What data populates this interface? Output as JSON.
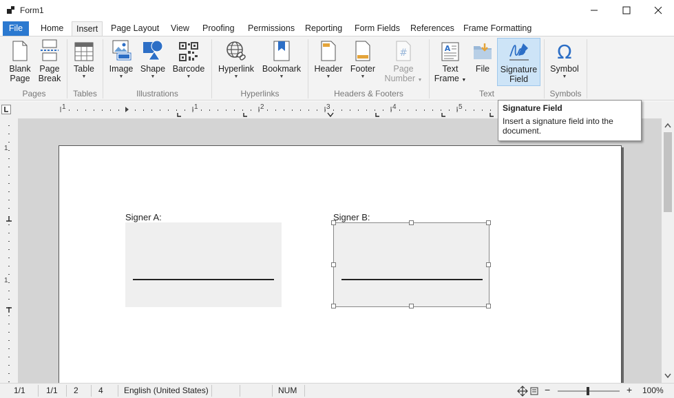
{
  "window": {
    "title": "Form1"
  },
  "tabs": [
    "File",
    "Home",
    "Insert",
    "Page Layout",
    "View",
    "Proofing",
    "Permissions",
    "Reporting",
    "Form Fields",
    "References",
    "Frame Formatting"
  ],
  "ribbon": {
    "blank_page": [
      "Blank",
      "Page"
    ],
    "page_break": [
      "Page",
      "Break"
    ],
    "table": "Table",
    "image": "Image",
    "shape": "Shape",
    "barcode": "Barcode",
    "hyperlink": "Hyperlink",
    "bookmark": "Bookmark",
    "header": "Header",
    "footer": "Footer",
    "page_number": [
      "Page",
      "Number"
    ],
    "text_frame": [
      "Text",
      "Frame"
    ],
    "file": "File",
    "signature_field": [
      "Signature",
      "Field"
    ],
    "symbol": "Symbol",
    "groups": {
      "pages": "Pages",
      "tables": "Tables",
      "illustrations": "Illustrations",
      "hyperlinks": "Hyperlinks",
      "headers_footers": "Headers & Footers",
      "text": "Text",
      "symbols": "Symbols"
    }
  },
  "ruler": {
    "h_numbers": [
      "1",
      "1",
      "2",
      "3",
      "4",
      "5"
    ],
    "v_numbers": [
      "1",
      "1"
    ]
  },
  "document": {
    "signer_a": "Signer A:",
    "signer_b": "Signer B:"
  },
  "tooltip": {
    "title": "Signature Field",
    "body": "Insert a signature field into the document."
  },
  "status": {
    "page": "1/1",
    "section": "1/1",
    "line": "2",
    "column": "4",
    "language": "English (United States)",
    "num": "NUM",
    "zoom": "100%"
  },
  "colors": {
    "file_tab": "#2b79d0",
    "icon_blue": "#2d6fc6",
    "highlight": "#cde4f7"
  }
}
